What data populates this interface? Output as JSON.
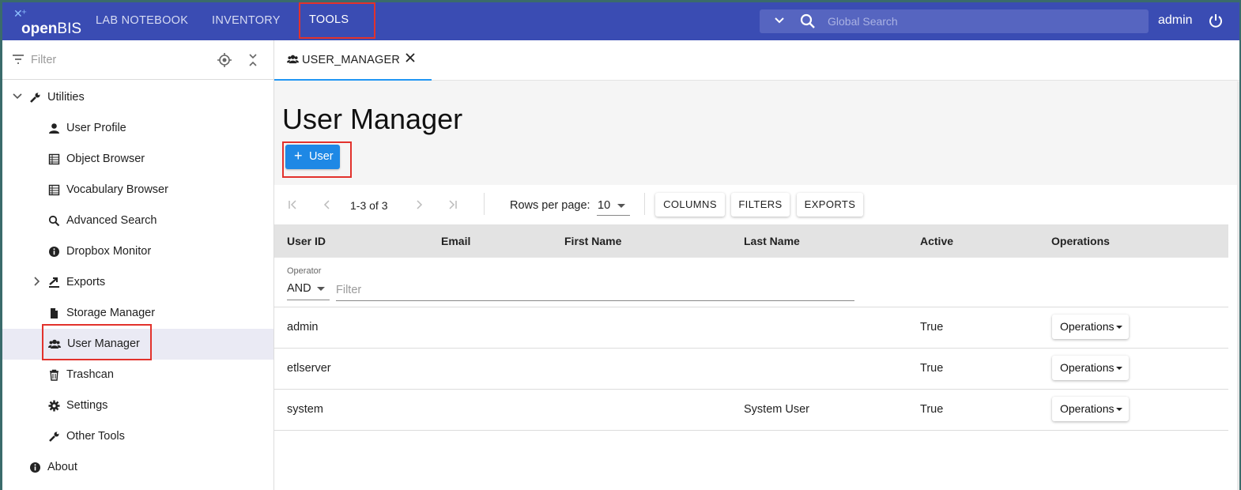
{
  "app": {
    "logo_text_bold": "open",
    "logo_text_light": "BIS",
    "nav": {
      "lab_notebook": "LAB NOTEBOOK",
      "inventory": "INVENTORY",
      "tools": "TOOLS"
    },
    "search": {
      "placeholder": "Global Search"
    },
    "user": "admin",
    "accent_color": "#3a4cb3",
    "highlight_color": "#e2322c"
  },
  "sidebar": {
    "filter_placeholder": "Filter",
    "root": {
      "label": "Utilities",
      "icon": "wrench-icon",
      "expanded": true
    },
    "items": [
      {
        "label": "User Profile",
        "icon": "person-icon"
      },
      {
        "label": "Object Browser",
        "icon": "table-icon"
      },
      {
        "label": "Vocabulary Browser",
        "icon": "table-icon"
      },
      {
        "label": "Advanced Search",
        "icon": "search-icon"
      },
      {
        "label": "Dropbox Monitor",
        "icon": "info-icon"
      },
      {
        "label": "Exports",
        "icon": "export-icon",
        "expandable": true
      },
      {
        "label": "Storage Manager",
        "icon": "file-icon"
      },
      {
        "label": "User Manager",
        "icon": "users-icon",
        "selected": true
      },
      {
        "label": "Trashcan",
        "icon": "trash-icon"
      },
      {
        "label": "Settings",
        "icon": "gear-icon"
      },
      {
        "label": "Other Tools",
        "icon": "wrench-icon"
      }
    ],
    "about": {
      "label": "About",
      "icon": "info-icon"
    }
  },
  "main": {
    "tab": {
      "label": "USER_MANAGER",
      "icon": "users-icon"
    },
    "title": "User Manager",
    "add_button": "User",
    "pager": {
      "range": "1-3 of 3",
      "rows_label": "Rows per page:",
      "rows_value": "10",
      "columns": "COLUMNS",
      "filters": "FILTERS",
      "exports": "EXPORTS"
    },
    "table": {
      "headers": [
        "User ID",
        "Email",
        "First Name",
        "Last Name",
        "Active",
        "Operations"
      ],
      "operator_label": "Operator",
      "operator_value": "AND",
      "filter_placeholder": "Filter",
      "rows": [
        {
          "user_id": "admin",
          "email": "",
          "first_name": "",
          "last_name": "",
          "active": "True",
          "operations": "Operations"
        },
        {
          "user_id": "etlserver",
          "email": "",
          "first_name": "",
          "last_name": "",
          "active": "True",
          "operations": "Operations"
        },
        {
          "user_id": "system",
          "email": "",
          "first_name": "",
          "last_name": "System User",
          "active": "True",
          "operations": "Operations"
        }
      ]
    }
  }
}
